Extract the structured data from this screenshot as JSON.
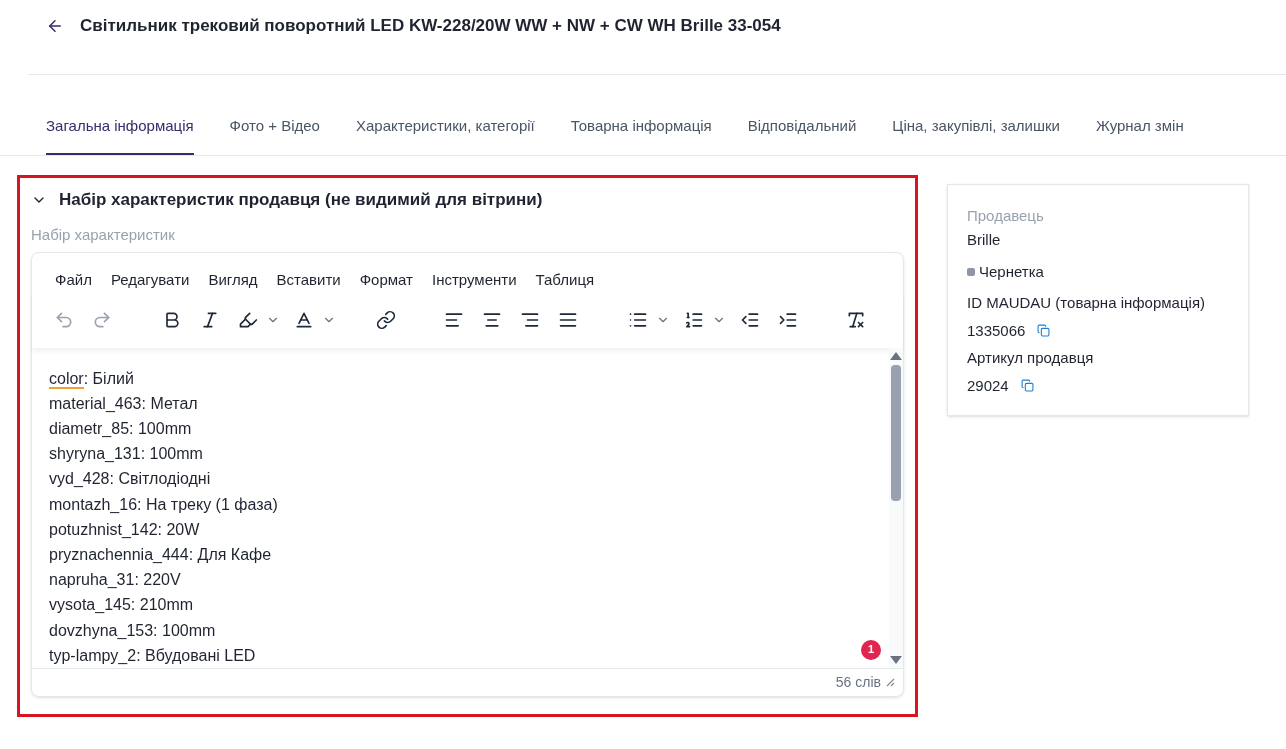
{
  "header": {
    "title": "Світильник трековий поворотний LED KW-228/20W WW + NW + CW WH Brille 33-054"
  },
  "tabs": [
    {
      "label": "Загальна інформація",
      "selected": true
    },
    {
      "label": "Фото + Відео",
      "selected": false
    },
    {
      "label": "Характеристики, категорії",
      "selected": false
    },
    {
      "label": "Товарна інформація",
      "selected": false
    },
    {
      "label": "Відповідальний",
      "selected": false
    },
    {
      "label": "Ціна, закупівлі, залишки",
      "selected": false
    },
    {
      "label": "Журнал змін",
      "selected": false
    }
  ],
  "section": {
    "title": "Набір характеристик продавця (не видимий для вітрини)",
    "expanded": true,
    "highlighted": true,
    "field_label": "Набір характеристик",
    "editor": {
      "menu": [
        "Файл",
        "Редагувати",
        "Вигляд",
        "Вставити",
        "Формат",
        "Інструменти",
        "Таблиця"
      ],
      "lines": [
        {
          "text": "color: Білий",
          "flagged": true
        },
        {
          "text": "material_463: Метал",
          "flagged": false
        },
        {
          "text": "diametr_85: 100mm",
          "flagged": false
        },
        {
          "text": "shyryna_131: 100mm",
          "flagged": false
        },
        {
          "text": "vyd_428: Світлодіодні",
          "flagged": false
        },
        {
          "text": "montazh_16: На треку (1 фаза)",
          "flagged": false
        },
        {
          "text": "potuzhnist_142: 20W",
          "flagged": false
        },
        {
          "text": "pryznachennia_444: Для Кафе",
          "flagged": false
        },
        {
          "text": "napruha_31: 220V",
          "flagged": false
        },
        {
          "text": "vysota_145: 210mm",
          "flagged": false
        },
        {
          "text": "dovzhyna_153: 100mm",
          "flagged": false
        },
        {
          "text": "typ-lampy_2: Вбудовані LED",
          "flagged": false
        }
      ],
      "badge": "1",
      "word_count": "56 слів"
    }
  },
  "seller_card": {
    "seller_label": "Продавець",
    "seller": "Brille",
    "status": {
      "label": "Чернетка",
      "color": "#8e95a3"
    },
    "id_label": "ID MAUDAU (товарна інформація)",
    "id": "1335066",
    "sku_label": "Артикул продавця",
    "sku": "29024"
  }
}
